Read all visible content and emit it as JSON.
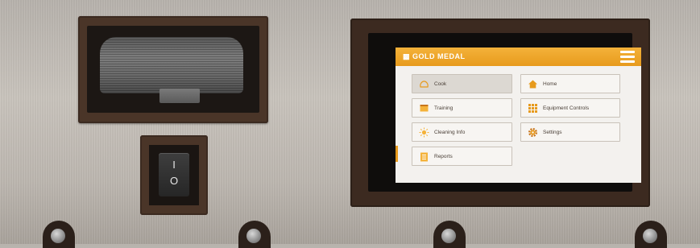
{
  "app": {
    "brand": "GOLD MEDAL",
    "accent_color": "#E89C1F",
    "header_menu_icon": "hamburger-menu-icon"
  },
  "menu": {
    "left": [
      {
        "label": "Cook",
        "icon": "cook-icon",
        "selected": true
      },
      {
        "label": "Training",
        "icon": "training-icon"
      },
      {
        "label": "Cleaning Info",
        "icon": "sun-icon"
      },
      {
        "label": "Reports",
        "icon": "clipboard-icon"
      }
    ],
    "right": [
      {
        "label": "Home",
        "icon": "home-icon"
      },
      {
        "label": "Equipment Controls",
        "icon": "grid-icon"
      },
      {
        "label": "Settings",
        "icon": "gear-icon"
      }
    ]
  },
  "power_switch": {
    "on_mark": "I",
    "off_mark": "O"
  }
}
